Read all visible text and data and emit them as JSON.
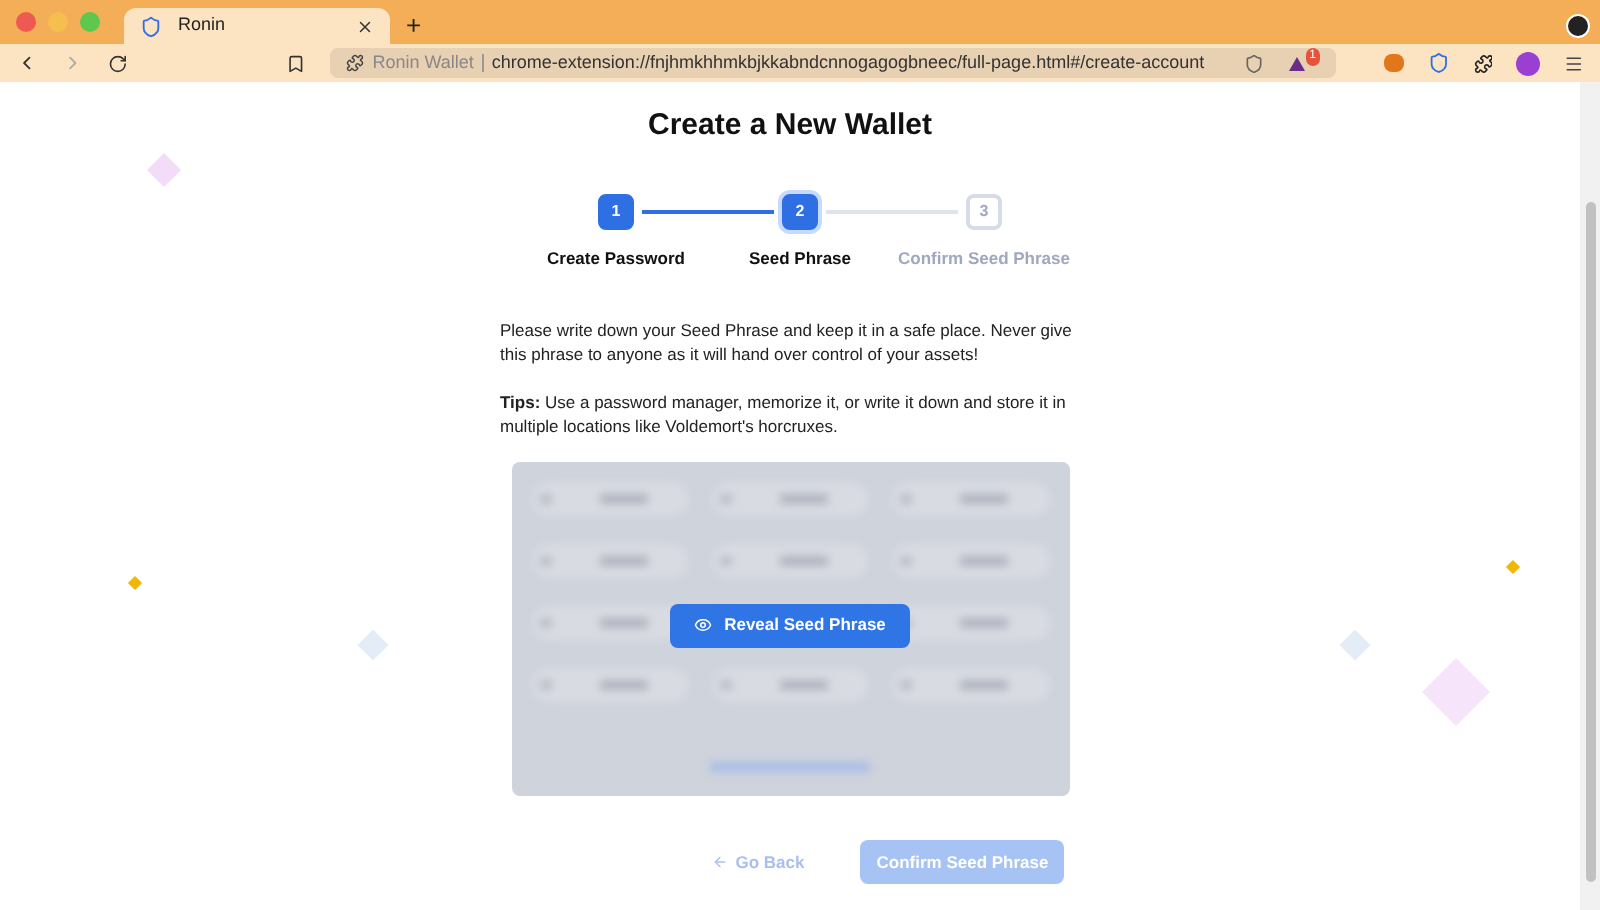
{
  "browser": {
    "tab_title": "Ronin",
    "new_tab": "+",
    "site_label": "Ronin Wallet",
    "url": "chrome-extension://fnjhmkhhmkbjkkabndcnnogagogbneec/full-page.html#/create-account",
    "notification_count": "1"
  },
  "page": {
    "title": "Create a New Wallet",
    "steps": [
      {
        "number": "1",
        "label": "Create Password",
        "completed": true,
        "selected": false
      },
      {
        "number": "2",
        "label": "Seed Phrase",
        "completed": false,
        "selected": true
      },
      {
        "number": "3",
        "label": "Confirm Seed Phrase",
        "completed": false,
        "selected": false
      }
    ],
    "intro": "Please write down your Seed Phrase and keep it in a safe place. Never give this phrase to anyone as it will hand over control of your assets!",
    "tips": "**Tips:** Use a password manager, memorize it, or write it down and store it in multiple locations like Voldemort's horcruxes.",
    "seed_panel": {
      "blurred": true,
      "reveal_button": "Reveal Seed Phrase"
    },
    "go_back": "Go Back",
    "confirm_button": {
      "label": "Confirm Seed Phrase",
      "disabled": true
    }
  }
}
